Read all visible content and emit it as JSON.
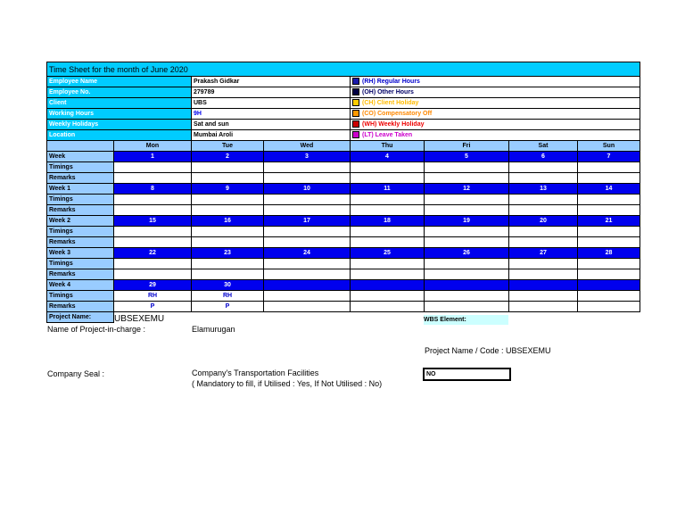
{
  "title": "Time Sheet for the month of June 2020",
  "info": [
    {
      "label": "Employee Name",
      "value": "Prakash Gidkar"
    },
    {
      "label": "Employee No.",
      "value": "279789"
    },
    {
      "label": "Client",
      "value": "UBS"
    },
    {
      "label": "Working Hours",
      "value": "9H"
    },
    {
      "label": "Weekly Holidays",
      "value": "Sat and sun"
    },
    {
      "label": "Location",
      "value": "Mumbai Aroli"
    }
  ],
  "legend": [
    {
      "text": "(RH) Regular Hours",
      "color": "#0000cc",
      "box": "#1a1aaa"
    },
    {
      "text": "(OH) Other Hours",
      "color": "#000066",
      "box": "#000044"
    },
    {
      "text": "(CH) Client Holiday",
      "color": "#ffbb00",
      "box": "#ffcc00"
    },
    {
      "text": "(CO) Compensatory Off",
      "color": "#ff8800",
      "box": "#ff9900"
    },
    {
      "text": "(WH) Weekly Holiday",
      "color": "#ee0000",
      "box": "#cc0000"
    },
    {
      "text": "(LT) Leave Taken",
      "color": "#cc00cc",
      "box": "#cc00cc"
    }
  ],
  "days": [
    "Mon",
    "Tue",
    "Wed",
    "Thu",
    "Fri",
    "Sat",
    "Sun"
  ],
  "weeks": [
    {
      "label": "Week",
      "dates": [
        "1",
        "2",
        "3",
        "4",
        "5",
        "6",
        "7"
      ],
      "timings_label": "Timings",
      "remarks_label": "Remarks",
      "timings": [
        "",
        "",
        "",
        "",
        "",
        "",
        ""
      ],
      "remarks": [
        "",
        "",
        "",
        "",
        "",
        "",
        ""
      ]
    },
    {
      "label": "Week 1",
      "dates": [
        "8",
        "9",
        "10",
        "11",
        "12",
        "13",
        "14"
      ],
      "timings_label": "Timings",
      "remarks_label": "Remarks",
      "timings": [
        "",
        "",
        "",
        "",
        "",
        "",
        ""
      ],
      "remarks": [
        "",
        "",
        "",
        "",
        "",
        "",
        ""
      ]
    },
    {
      "label": "Week 2",
      "dates": [
        "15",
        "16",
        "17",
        "18",
        "19",
        "20",
        "21"
      ],
      "timings_label": "Timings",
      "remarks_label": "Remarks",
      "timings": [
        "",
        "",
        "",
        "",
        "",
        "",
        ""
      ],
      "remarks": [
        "",
        "",
        "",
        "",
        "",
        "",
        ""
      ]
    },
    {
      "label": "Week 3",
      "dates": [
        "22",
        "23",
        "24",
        "25",
        "26",
        "27",
        "28"
      ],
      "timings_label": "Timings",
      "remarks_label": "Remarks",
      "timings": [
        "",
        "",
        "",
        "",
        "",
        "",
        ""
      ],
      "remarks": [
        "",
        "",
        "",
        "",
        "",
        "",
        ""
      ]
    },
    {
      "label": "Week 4",
      "dates": [
        "29",
        "30",
        "",
        "",
        "",
        "",
        ""
      ],
      "timings_label": "Timings",
      "remarks_label": "Remarks",
      "timings": [
        "RH",
        "RH",
        "",
        "",
        "",
        "",
        ""
      ],
      "remarks": [
        "P",
        "P",
        "",
        "",
        "",
        "",
        ""
      ]
    }
  ],
  "footer": {
    "project_label": "Project Name:",
    "project_value": "UBSEXEMU",
    "wbs_label": "WBS Element:",
    "incharge_label": "Name of Project-in-charge :",
    "incharge_value": "Elamurugan",
    "project_code": "Project Name / Code :  UBSEXEMU",
    "seal_label": "Company Seal :",
    "transport_label": "Company's Transportation Facilities",
    "transport_note": "( Mandatory to fill, if Utilised : Yes, If Not Utilised : No)",
    "transport_value": "NO"
  }
}
